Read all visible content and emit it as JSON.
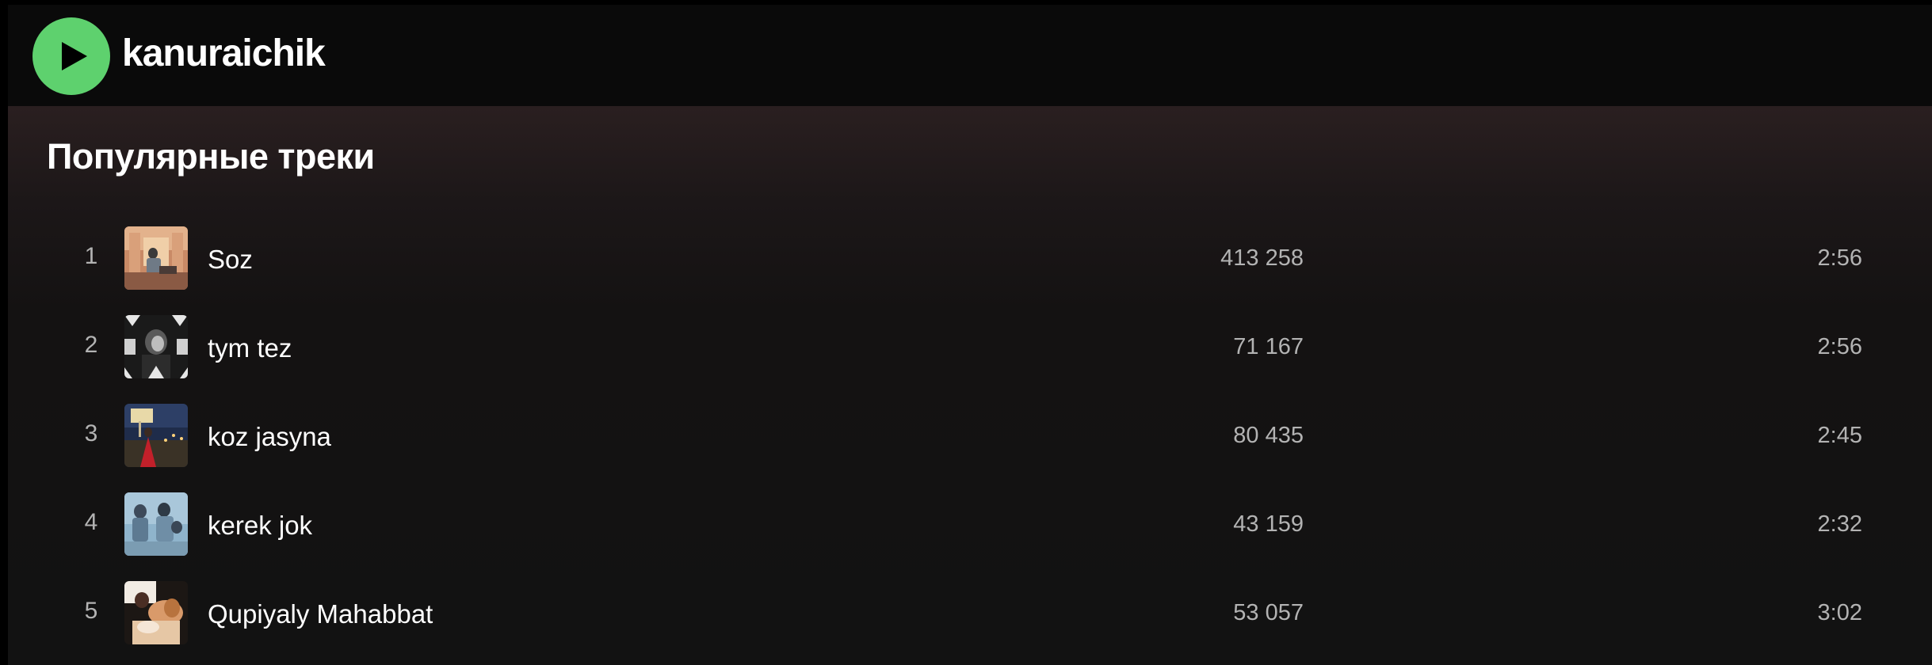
{
  "header": {
    "artist_name": "kanuraichik",
    "play_icon": "play-icon",
    "accent_color": "#5ed16e"
  },
  "section": {
    "title": "Популярные треки"
  },
  "tracks": [
    {
      "number": "1",
      "title": "Soz",
      "plays": "413 258",
      "duration": "2:56"
    },
    {
      "number": "2",
      "title": "tym tez",
      "plays": "71 167",
      "duration": "2:56"
    },
    {
      "number": "3",
      "title": "koz jasyna",
      "plays": "80 435",
      "duration": "2:45"
    },
    {
      "number": "4",
      "title": "kerek jok",
      "plays": "43 159",
      "duration": "2:32"
    },
    {
      "number": "5",
      "title": "Qupiyaly Mahabbat",
      "plays": "53 057",
      "duration": "3:02"
    }
  ]
}
